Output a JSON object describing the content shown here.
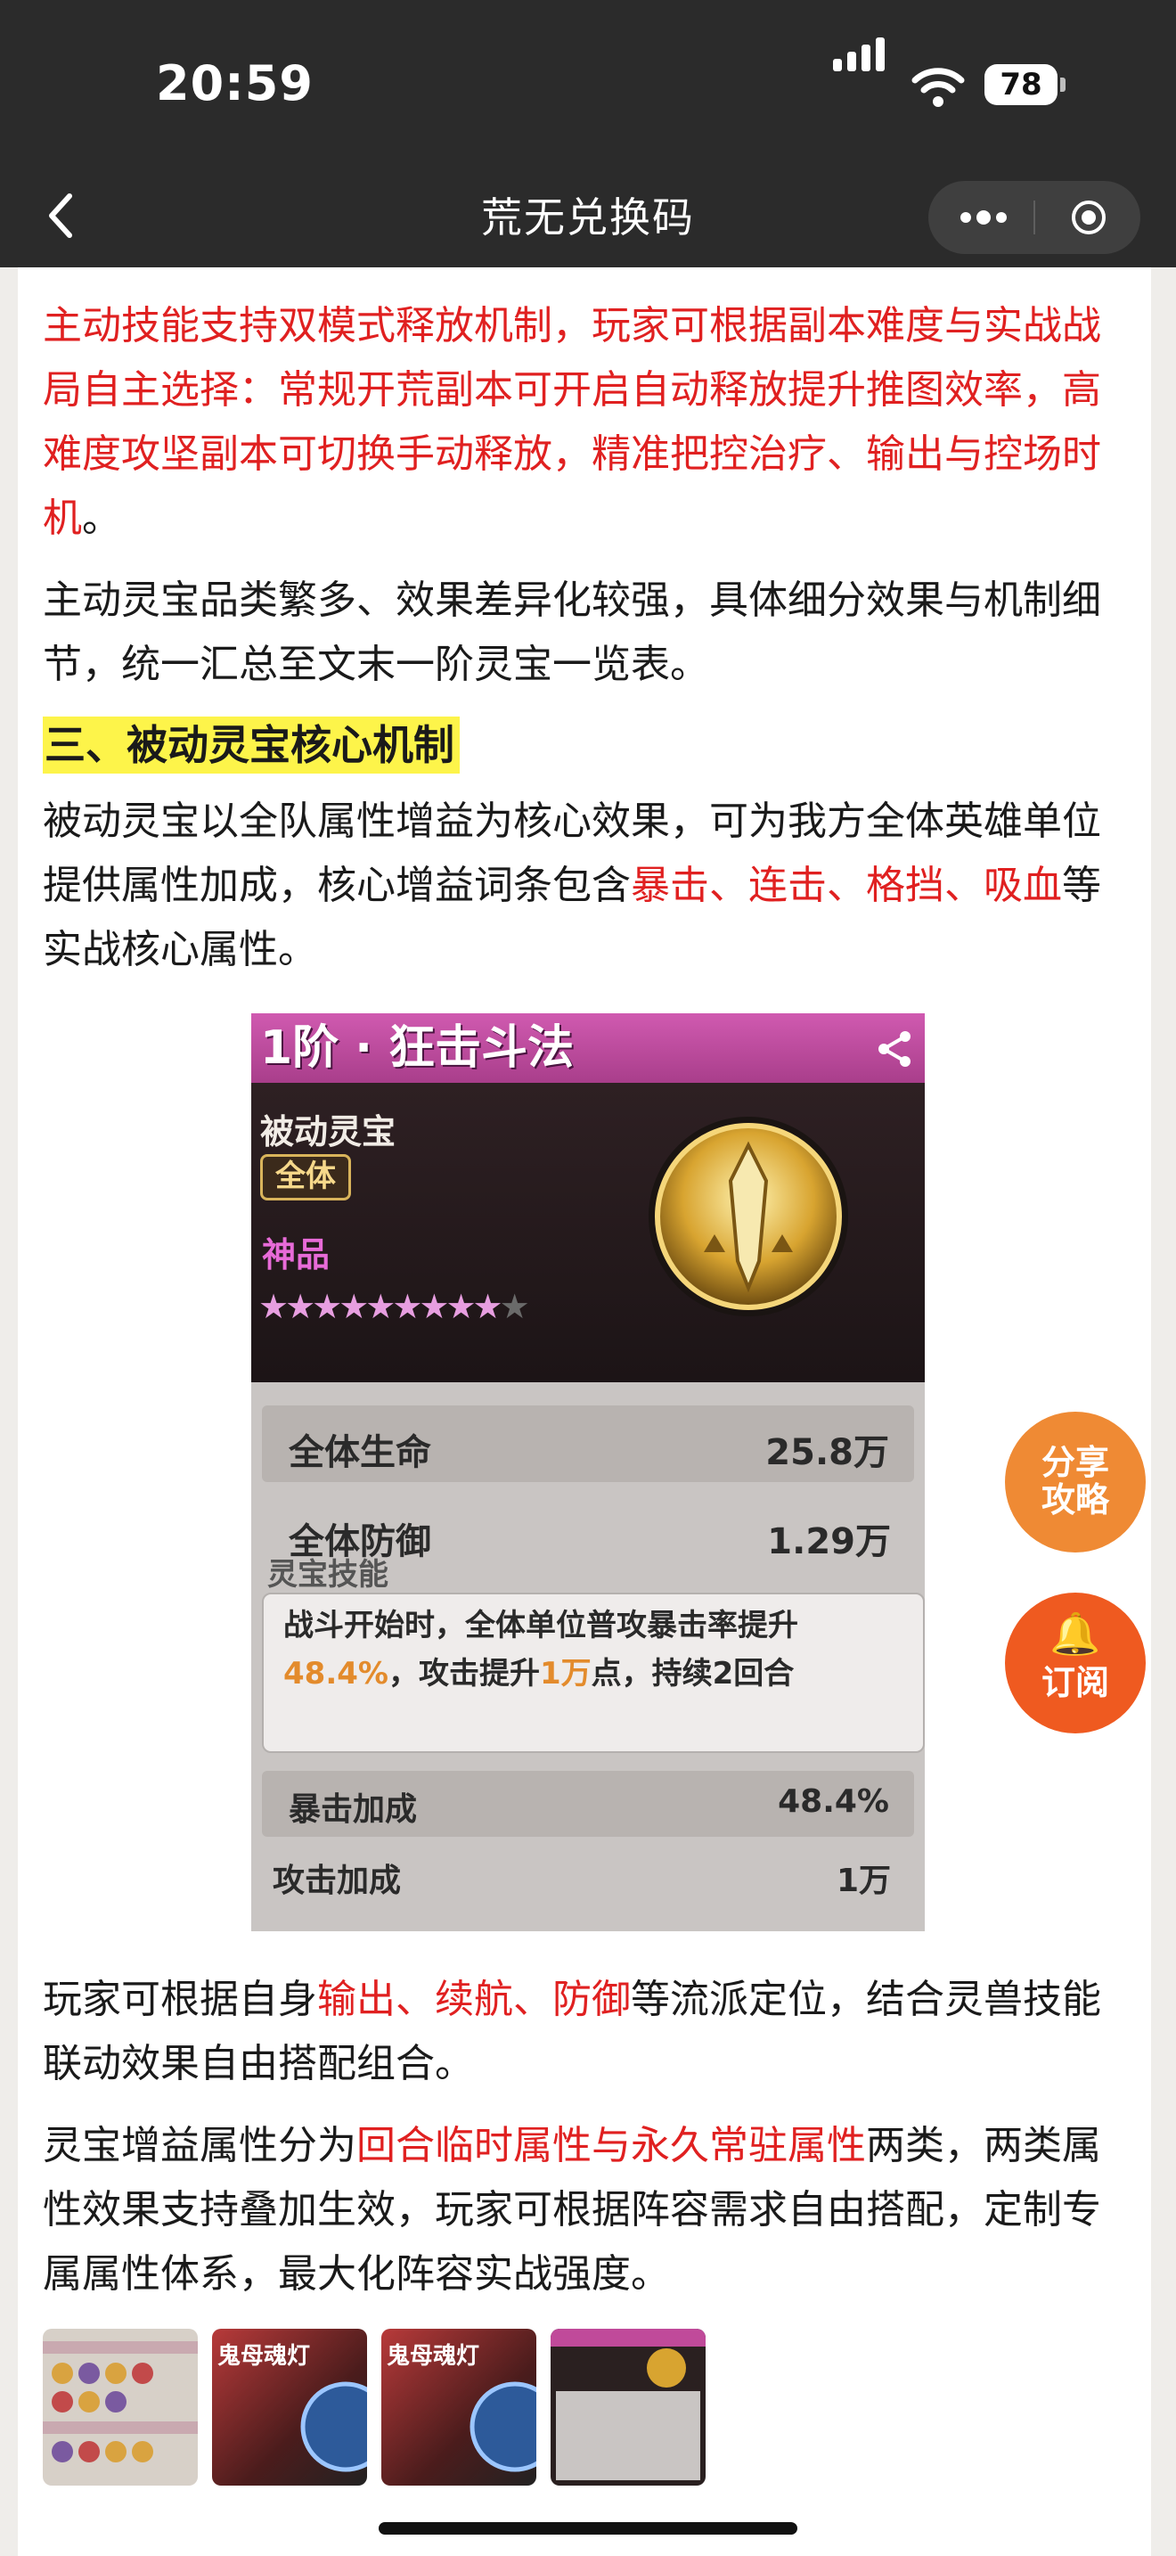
{
  "status_bar": {
    "time": "20:59",
    "battery": "78"
  },
  "nav": {
    "title": "荒无兑换码"
  },
  "article": {
    "p1_red": "主动技能支持双模式释放机制，玩家可根据副本难度与实战战局自主选择：常规开荒副本可开启自动释放提升推图效率，高难度攻坚副本可切换手动释放，精准把控治疗、输出与控场时机",
    "p1_end": "。",
    "p2": "主动灵宝品类繁多、效果差异化较强，具体细分效果与机制细节，统一汇总至文末一阶灵宝一览表。",
    "heading": "三、被动灵宝核心机制",
    "p3_a": "被动灵宝以全队属性增益为核心效果，可为我方全体英雄单位提供属性加成，核心增益词条包含",
    "p3_red": "暴击、连击、格挡、吸血",
    "p3_b": "等实战核心属性。",
    "p4_a": "玩家可根据自身",
    "p4_red": "输出、续航、防御",
    "p4_b": "等流派定位，结合灵兽技能联动效果自由搭配组合。",
    "p5_a": "灵宝增益属性分为",
    "p5_red": "回合临时属性与永久常驻属性",
    "p5_b": "两类，两类属性效果支持叠加生效，玩家可根据阵容需求自由搭配，定制专属属性体系，最大化阵容实战强度。"
  },
  "card": {
    "title": "1阶 · 狂击斗法",
    "type": "被动灵宝",
    "scope": "全体",
    "rarity": "神品",
    "stars_filled": "★★★★★★★★★",
    "stars_empty": "★",
    "stats": [
      {
        "label": "全体生命",
        "value": "25.8万"
      },
      {
        "label": "全体防御",
        "value": "1.29万"
      }
    ],
    "skill_heading": "灵宝技能",
    "skill_a": "战斗开始时，全体单位普攻暴击率提升",
    "skill_pct": "48.4%",
    "skill_b": "，攻击提升",
    "skill_atk": "1万",
    "skill_c": "点，持续2回合",
    "bonuses": [
      {
        "label": "暴击加成",
        "value": "48.4%"
      },
      {
        "label": "攻击加成",
        "value": "1万"
      }
    ]
  },
  "fab": {
    "share": "分享攻略",
    "share_l1": "分享",
    "share_l2": "攻略",
    "subscribe": "订阅"
  },
  "thumbnails": {
    "t2_label": "鬼母魂灯",
    "t3_label": "鬼母魂灯"
  },
  "colors": {
    "accent_red": "#e02020",
    "highlight": "#fdf44a",
    "fab_orange": "#ef8a34"
  }
}
